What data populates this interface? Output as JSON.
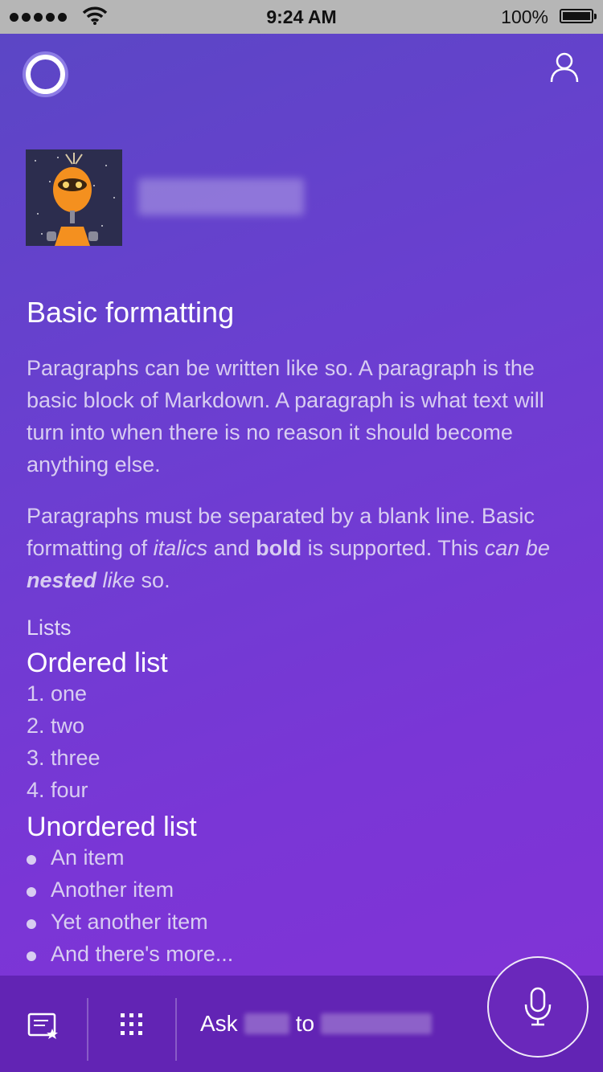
{
  "status_bar": {
    "time": "9:24 AM",
    "battery_pct": "100%"
  },
  "header": {
    "assistant_icon": "cortana-ring-icon",
    "profile_icon": "person-icon"
  },
  "card": {
    "title": "Basic formatting",
    "para1": "Paragraphs can be written like so. A paragraph is the basic block of Markdown. A paragraph is what text will turn into when there is no reason it should become anything else.",
    "para2": {
      "t1": "Paragraphs must be separated by a blank line. Basic formatting of ",
      "italic": "italics",
      "t2": " and ",
      "bold": "bold",
      "t3": " is supported. This ",
      "nested_italic1": "can be ",
      "nested_bold_italic": "nested",
      "nested_italic2": " like",
      "t4": " so."
    },
    "lists_label": "Lists",
    "ordered_heading": "Ordered list",
    "ordered_items": [
      "1. one",
      "2. two",
      "3. three",
      "4. four"
    ],
    "unordered_heading": "Unordered list",
    "unordered_items": [
      "An item",
      "Another item",
      "Yet another item",
      "And there's more..."
    ]
  },
  "bottom_bar": {
    "notebook_icon": "notebook-star-icon",
    "apps_icon": "grid-icon",
    "ask_label": "Ask",
    "to_label": "to",
    "mic_icon": "microphone-icon"
  }
}
